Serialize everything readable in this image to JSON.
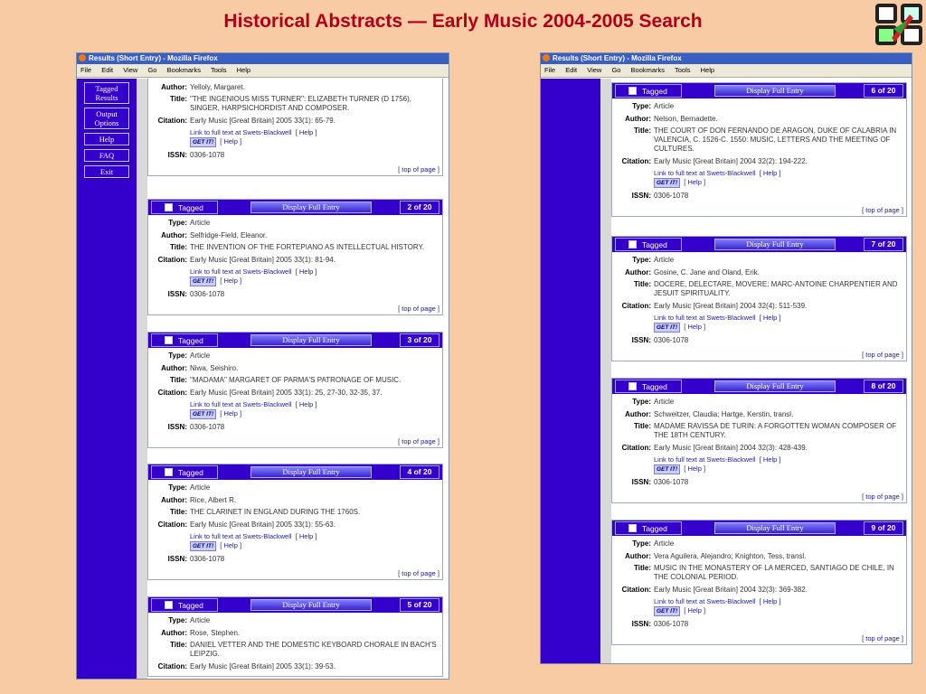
{
  "slide_title": "Historical Abstracts — Early Music 2004-2005 Search",
  "browser": {
    "window_title": "Results (Short Entry) - Mozilla Firefox",
    "menus": [
      "File",
      "Edit",
      "View",
      "Go",
      "Bookmarks",
      "Tools",
      "Help"
    ]
  },
  "sidebar": {
    "items": [
      {
        "label_line1": "Tagged",
        "label_line2": "Results"
      },
      {
        "label_line1": "Output",
        "label_line2": "Options"
      },
      {
        "label_line1": "Help",
        "label_line2": ""
      },
      {
        "label_line1": "FAQ",
        "label_line2": ""
      },
      {
        "label_line1": "Exit",
        "label_line2": ""
      }
    ]
  },
  "labels": {
    "type": "Type:",
    "author": "Author:",
    "title": "Title:",
    "citation": "Citation:",
    "issn": "ISSN:",
    "tagged": "Tagged",
    "display_full": "Display Full Entry",
    "link_fulltext": "Link to full text at Swets-Blackwell",
    "help": "Help",
    "getit": "GET IT!",
    "top_of_page": "top of page"
  },
  "left_records": [
    {
      "count": "",
      "type": "Article",
      "author": "Yelloly, Margaret.",
      "title": "\"THE INGENIOUS MISS TURNER\": ELIZABETH TURNER (D 1756), SINGER, HARPSICHORDIST AND COMPOSER.",
      "citation": "Early Music [Great Britain] 2005 33(1): 65-79.",
      "issn": "0306-1078"
    },
    {
      "count": "2 of 20",
      "type": "Article",
      "author": "Selfridge-Field, Eleanor.",
      "title": "THE INVENTION OF THE FORTEPIANO AS INTELLECTUAL HISTORY.",
      "citation": "Early Music [Great Britain] 2005 33(1): 81-94.",
      "issn": "0306-1078"
    },
    {
      "count": "3 of 20",
      "type": "Article",
      "author": "Niwa, Seishiro.",
      "title": "\"MADAMA\" MARGARET OF PARMA'S PATRONAGE OF MUSIC.",
      "citation": "Early Music [Great Britain] 2005 33(1): 25, 27-30, 32-35, 37.",
      "issn": "0306-1078"
    },
    {
      "count": "4 of 20",
      "type": "Article",
      "author": "Rice, Albert R.",
      "title": "THE CLARINET IN ENGLAND DURING THE 1760S.",
      "citation": "Early Music [Great Britain] 2005 33(1): 55-63.",
      "issn": "0306-1078"
    },
    {
      "count": "5 of 20",
      "type": "Article",
      "author": "Rose, Stephen.",
      "title": "DANIEL VETTER AND THE DOMESTIC KEYBOARD CHORALE IN BACH'S LEIPZIG.",
      "citation": "Early Music [Great Britain] 2005 33(1): 39-53.",
      "issn": ""
    }
  ],
  "right_records": [
    {
      "count": "6 of 20",
      "type": "Article",
      "author": "Nelson, Bernadette.",
      "title": "THE COURT OF DON FERNANDO DE ARAGON, DUKE OF CALABRIA IN VALENCIA, C. 1526-C. 1550: MUSIC, LETTERS AND THE MEETING OF CULTURES.",
      "citation": "Early Music [Great Britain] 2004 32(2): 194-222.",
      "issn": "0306-1078"
    },
    {
      "count": "7 of 20",
      "type": "Article",
      "author": "Gosine, C. Jane and Oland, Erik.",
      "title": "DOCERE, DELECTARE, MOVERE: MARC-ANTOINE CHARPENTIER AND JESUIT SPIRITUALITY.",
      "citation": "Early Music [Great Britain] 2004 32(4): 511-539.",
      "issn": "0306-1078"
    },
    {
      "count": "8 of 20",
      "type": "Article",
      "author": "Schweitzer, Claudia; Hartge, Kerstin, transl.",
      "title": "MADAME RAVISSA DE TURIN: A FORGOTTEN WOMAN COMPOSER OF THE 18TH CENTURY.",
      "citation": "Early Music [Great Britain] 2004 32(3): 428-439.",
      "issn": "0306-1078"
    },
    {
      "count": "9 of 20",
      "type": "Article",
      "author": "Vera Aguilera, Alejandro; Knighton, Tess, transl.",
      "title": "MUSIC IN THE MONASTERY OF LA MERCED, SANTIAGO DE CHILE, IN THE COLONIAL PERIOD.",
      "citation": "Early Music [Great Britain] 2004 32(3): 369-382.",
      "issn": "0306-1078"
    }
  ]
}
